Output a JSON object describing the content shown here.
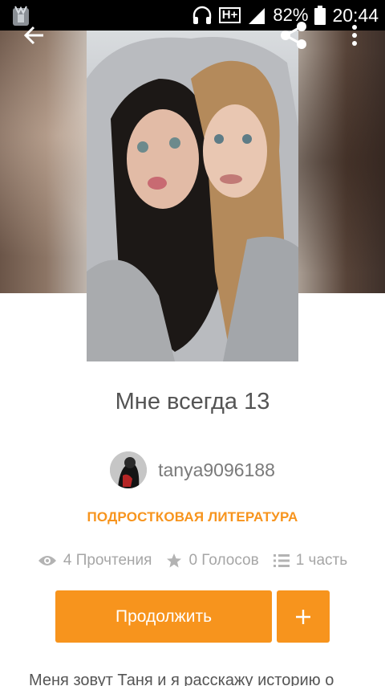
{
  "status_bar": {
    "network": "H+",
    "battery_percent": "82%",
    "time": "20:44"
  },
  "story": {
    "title": "Мне всегда 13",
    "author": "tanya9096188",
    "category": "ПОДРОСТКОВАЯ ЛИТЕРАТУРА",
    "reads": "4 Прочтения",
    "votes": "0 Голосов",
    "parts": "1 часть",
    "description": "Меня зовут Таня и я расскажу историю о"
  },
  "actions": {
    "continue_label": "Продолжить",
    "add_label": "+"
  },
  "icons": {
    "back": "arrow-back-icon",
    "share": "share-icon",
    "more": "more-vert-icon",
    "reads": "eye-icon",
    "votes": "star-icon",
    "parts": "list-icon"
  },
  "colors": {
    "accent": "#f7941d",
    "status_bar": "#000000",
    "title_text": "#545454",
    "muted_text": "#a6a6a6"
  }
}
